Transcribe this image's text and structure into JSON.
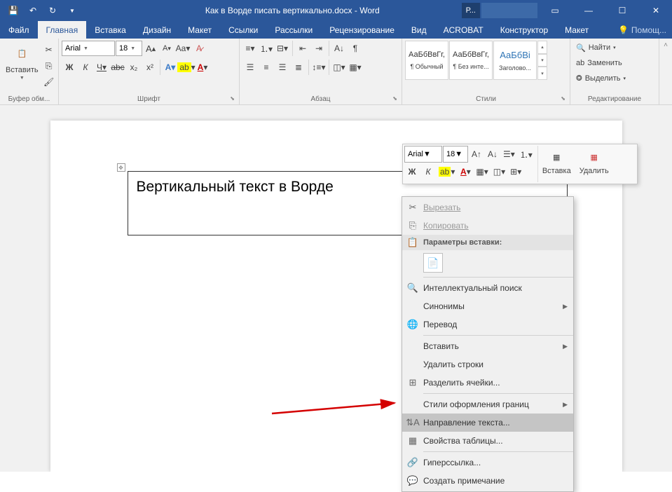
{
  "titlebar": {
    "doc_title": "Как в Ворде писать вертикально.docx - Word",
    "account_initial": "Р..."
  },
  "tabs": {
    "file": "Файл",
    "home": "Главная",
    "insert": "Вставка",
    "design": "Дизайн",
    "layout": "Макет",
    "references": "Ссылки",
    "mailings": "Рассылки",
    "review": "Рецензирование",
    "view": "Вид",
    "acrobat": "ACROBAT",
    "constructor": "Конструктор",
    "layout2": "Макет",
    "tellme": "Помощ..."
  },
  "ribbon": {
    "clipboard": {
      "paste": "Вставить",
      "label": "Буфер обм..."
    },
    "font": {
      "family": "Arial",
      "size": "18",
      "bold": "Ж",
      "italic": "К",
      "underline": "Ч",
      "strike": "abc",
      "label": "Шрифт"
    },
    "paragraph": {
      "label": "Абзац"
    },
    "styles": {
      "label": "Стили",
      "items": [
        {
          "sample": "АаБбВвГг,",
          "name": "¶ Обычный"
        },
        {
          "sample": "АаБбВвГг,",
          "name": "¶ Без инте..."
        },
        {
          "sample": "АаБбВі",
          "name": "Заголово..."
        }
      ]
    },
    "editing": {
      "find": "Найти",
      "replace": "Заменить",
      "select": "Выделить",
      "label": "Редактирование"
    }
  },
  "document": {
    "table_text": "Вертикальный текст в Ворде"
  },
  "mini": {
    "font": "Arial",
    "size": "18",
    "bold": "Ж",
    "italic": "К",
    "insert": "Вставка",
    "delete": "Удалить"
  },
  "context": {
    "cut": "Вырезать",
    "copy": "Копировать",
    "paste_header": "Параметры вставки:",
    "smart_lookup": "Интеллектуальный поиск",
    "synonyms": "Синонимы",
    "translate": "Перевод",
    "insert": "Вставить",
    "delete_rows": "Удалить строки",
    "split_cells": "Разделить ячейки...",
    "border_styles": "Стили оформления границ",
    "text_direction": "Направление текста...",
    "table_props": "Свойства таблицы...",
    "hyperlink": "Гиперссылка...",
    "new_comment": "Создать примечание"
  }
}
